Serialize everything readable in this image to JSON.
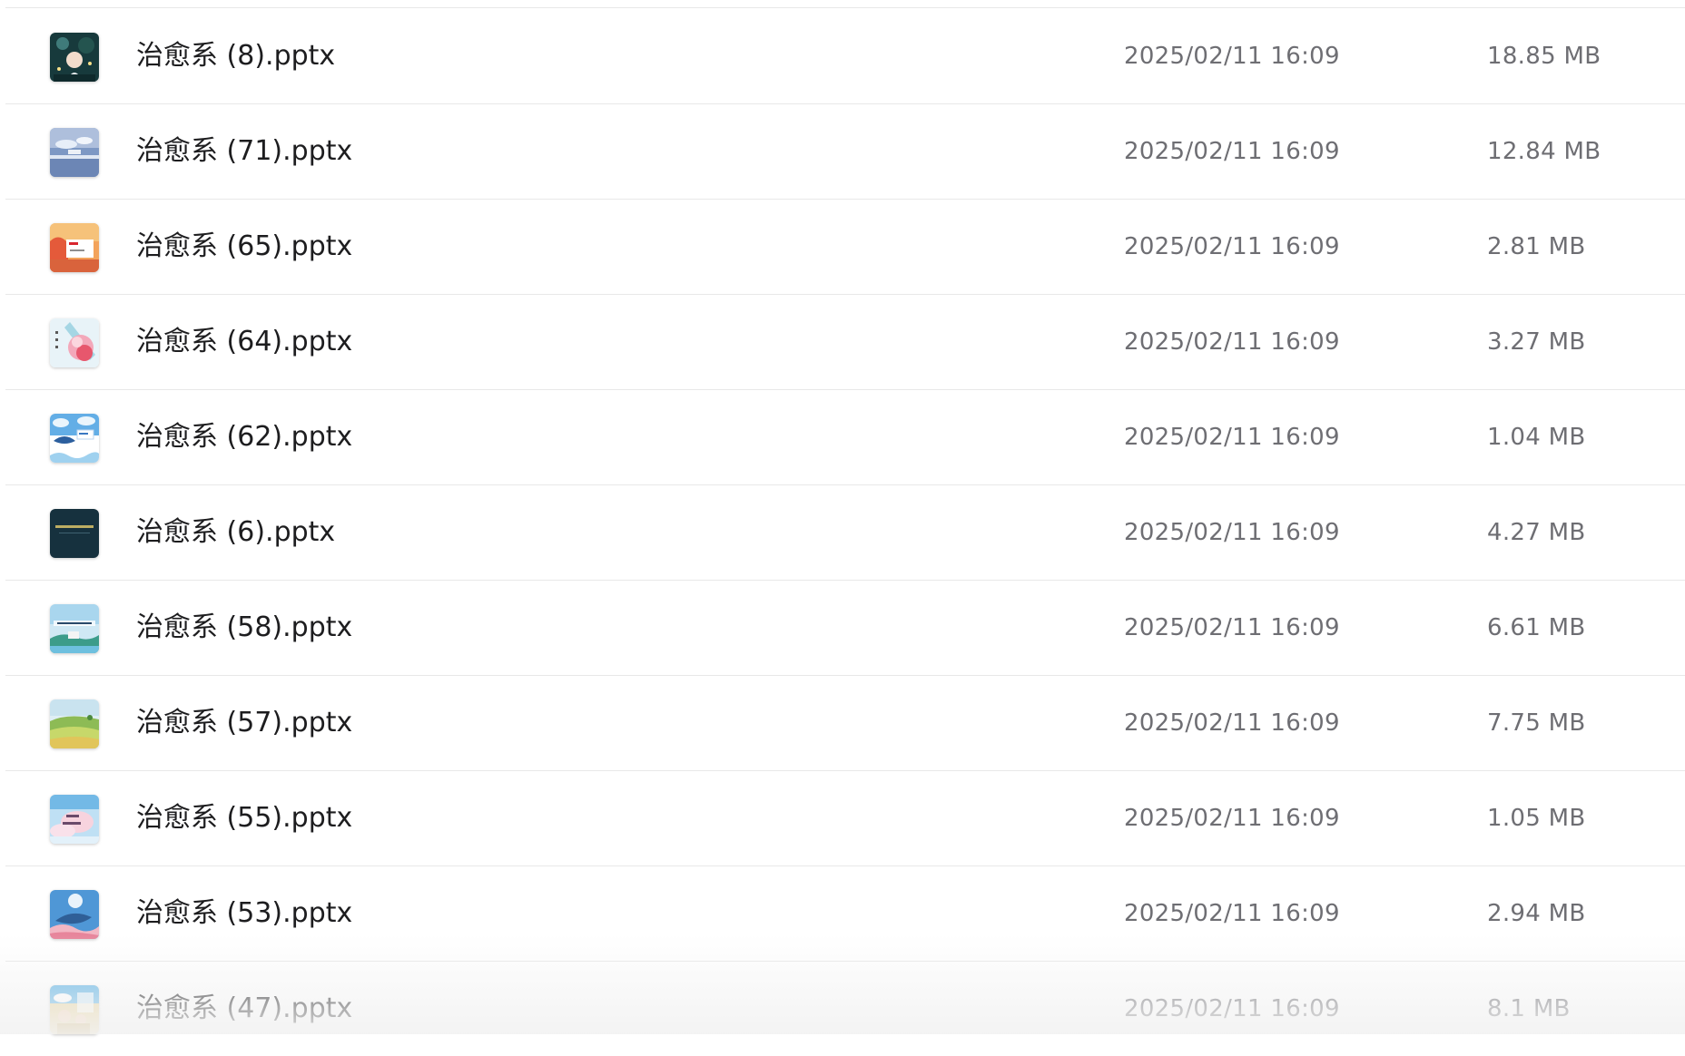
{
  "files": [
    {
      "name": "治愈系 (8).pptx",
      "modified": "2025/02/11 16:09",
      "size": "18.85 MB",
      "thumb_icon": "thumb-night-girl-icon"
    },
    {
      "name": "治愈系 (71).pptx",
      "modified": "2025/02/11 16:09",
      "size": "12.84 MB",
      "thumb_icon": "thumb-sky-lake-icon"
    },
    {
      "name": "治愈系 (65).pptx",
      "modified": "2025/02/11 16:09",
      "size": "2.81 MB",
      "thumb_icon": "thumb-sunset-card-icon"
    },
    {
      "name": "治愈系 (64).pptx",
      "modified": "2025/02/11 16:09",
      "size": "3.27 MB",
      "thumb_icon": "thumb-pink-flower-icon"
    },
    {
      "name": "治愈系 (62).pptx",
      "modified": "2025/02/11 16:09",
      "size": "1.04 MB",
      "thumb_icon": "thumb-whale-sky-icon"
    },
    {
      "name": "治愈系 (6).pptx",
      "modified": "2025/02/11 16:09",
      "size": "4.27 MB",
      "thumb_icon": "thumb-dark-teal-icon"
    },
    {
      "name": "治愈系 (58).pptx",
      "modified": "2025/02/11 16:09",
      "size": "6.61 MB",
      "thumb_icon": "thumb-watercolor-village-icon"
    },
    {
      "name": "治愈系 (57).pptx",
      "modified": "2025/02/11 16:09",
      "size": "7.75 MB",
      "thumb_icon": "thumb-green-field-icon"
    },
    {
      "name": "治愈系 (55).pptx",
      "modified": "2025/02/11 16:09",
      "size": "1.05 MB",
      "thumb_icon": "thumb-pink-sky-icon"
    },
    {
      "name": "治愈系 (53).pptx",
      "modified": "2025/02/11 16:09",
      "size": "2.94 MB",
      "thumb_icon": "thumb-moon-whale-icon"
    },
    {
      "name": "治愈系 (47).pptx",
      "modified": "2025/02/11 16:09",
      "size": "8.1 MB",
      "thumb_icon": "thumb-cartoon-kids-icon"
    }
  ],
  "colors": {
    "text_primary": "#1d1d1f",
    "text_secondary": "#6e6e73",
    "divider": "#e8e8e8"
  }
}
